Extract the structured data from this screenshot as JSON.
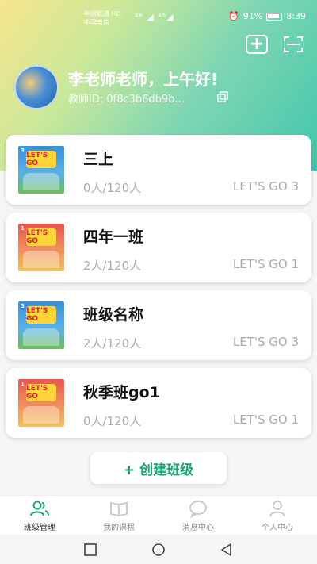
{
  "status_bar": {
    "carrier_1": "中国联通 HD",
    "carrier_2": "中国电信",
    "signal": "⁴⁶ ◢ ⁴⁶◢",
    "battery_pct": "91%",
    "time": "8:39"
  },
  "header": {
    "greeting": "李老师老师，上午好!",
    "teacher_id": "教师ID: 0f8c3b6db9b..."
  },
  "classes": [
    {
      "name": "三上",
      "count": "0人/120人",
      "book": "LET'S GO 3",
      "cover_level": "3",
      "cover_color": "blue"
    },
    {
      "name": "四年一班",
      "count": "2人/120人",
      "book": "LET'S GO 1",
      "cover_level": "1",
      "cover_color": "pink"
    },
    {
      "name": "班级名称",
      "count": "2人/120人",
      "book": "LET'S GO 3",
      "cover_level": "3",
      "cover_color": "blue"
    },
    {
      "name": "秋季班go1",
      "count": "0人/120人",
      "book": "LET'S GO 1",
      "cover_level": "1",
      "cover_color": "pink"
    }
  ],
  "create_button": "+ 创建班级",
  "tabs": [
    {
      "label": "班级管理",
      "icon": "people-icon",
      "active": true
    },
    {
      "label": "我的课程",
      "icon": "book-icon",
      "active": false
    },
    {
      "label": "消息中心",
      "icon": "chat-icon",
      "active": false
    },
    {
      "label": "个人中心",
      "icon": "person-icon",
      "active": false
    }
  ],
  "colors": {
    "accent": "#1aa37a",
    "header_gradient_start": "#f6e58d",
    "header_gradient_end": "#43c6ac"
  }
}
